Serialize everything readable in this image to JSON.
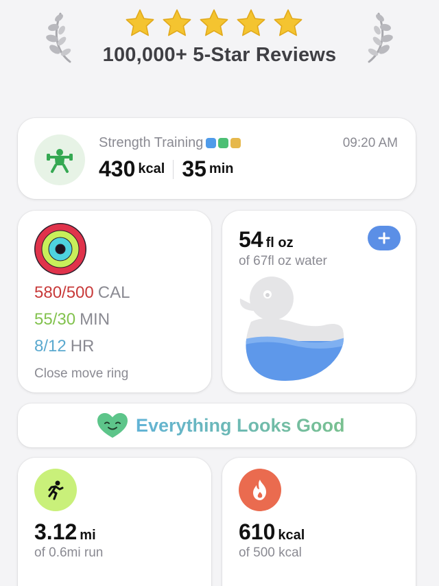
{
  "header": {
    "rating_stars": 5,
    "reviews_label": "100,000+ 5-Star Reviews"
  },
  "workout": {
    "title": "Strength Training",
    "time": "09:20 AM",
    "calories": "430",
    "calories_unit": "kcal",
    "duration": "35",
    "duration_unit": "min",
    "icon": "weightlifter-icon",
    "dot_colors": [
      "#4f9bea",
      "#4cbf74",
      "#e6b84c"
    ]
  },
  "activity": {
    "move": {
      "value": "580/500",
      "label": "CAL",
      "color": "#c83a3a"
    },
    "exercise": {
      "value": "55/30",
      "label": "MIN",
      "color": "#82c24e"
    },
    "stand": {
      "value": "8/12",
      "label": "HR",
      "color": "#5aa9cf"
    },
    "hint": "Close move ring",
    "label_color": "#8a8a92"
  },
  "water": {
    "amount": "54",
    "unit": "fl oz",
    "goal_text": "of 67fl oz water",
    "fill_fraction": 0.81,
    "add_icon": "plus-icon",
    "duck_icon": "rubber-duck-icon"
  },
  "status": {
    "text": "Everything Looks Good",
    "icon": "smiling-heart-icon"
  },
  "run": {
    "value": "3.12",
    "unit": "mi",
    "goal_text": "of 0.6mi run",
    "icon": "running-icon",
    "icon_bg": "#c9f07a"
  },
  "calories": {
    "value": "610",
    "unit": "kcal",
    "goal_text": "of 500 kcal",
    "icon": "flame-icon",
    "icon_bg": "#ea6b4f"
  }
}
